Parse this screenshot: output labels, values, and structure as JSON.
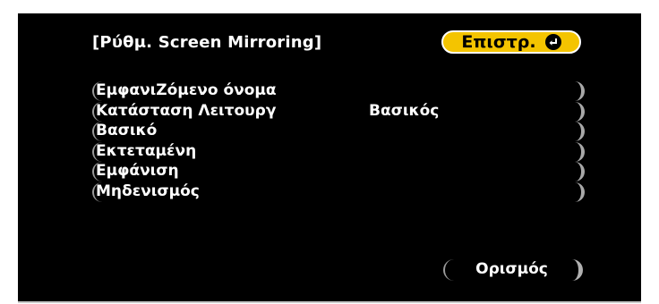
{
  "header": {
    "title": "[Ρύθμ. Screen Mirroring]",
    "back_label": "Επιστρ.",
    "back_icon": "enter-icon"
  },
  "menu": {
    "items": [
      {
        "label": "ΕμφανιΖόμενο όνομα",
        "value": ""
      },
      {
        "label": "Κατάσταση Λειτουργ",
        "value": "Βασικός"
      },
      {
        "label": "Βασικό",
        "value": ""
      },
      {
        "label": "Εκτεταμένη",
        "value": ""
      },
      {
        "label": "Εμφάνιση",
        "value": ""
      },
      {
        "label": "Μηδενισμός",
        "value": ""
      }
    ]
  },
  "footer": {
    "set_label": "Ορισμός"
  },
  "colors": {
    "background": "#000000",
    "accent": "#f4c400",
    "text": "#ffffff"
  }
}
